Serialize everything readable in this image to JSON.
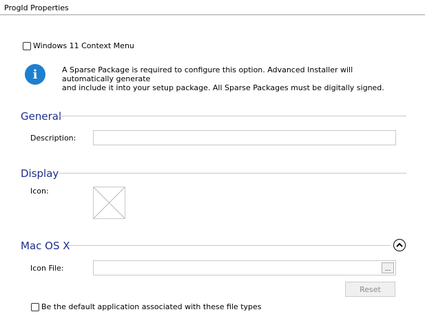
{
  "header": {
    "title": "ProgId Properties"
  },
  "context_menu": {
    "checkbox_label": "Windows 11 Context Menu",
    "checked": false
  },
  "info": {
    "icon": "info-icon",
    "line1": "A Sparse Package is required to configure this option. Advanced Installer will automatically generate",
    "line2": "and include it into your setup package. All Sparse Packages must be digitally signed."
  },
  "general": {
    "heading": "General",
    "description_label": "Description:",
    "description_value": ""
  },
  "display": {
    "heading": "Display",
    "icon_label": "Icon:"
  },
  "mac": {
    "heading": "Mac OS X",
    "collapse_icon": "chevron-up-icon",
    "icon_file_label": "Icon File:",
    "icon_file_value": "",
    "browse_label": "...",
    "reset_label": "Reset"
  },
  "default_app": {
    "checkbox_label": "Be the default application associated with these file types",
    "checked": false
  }
}
